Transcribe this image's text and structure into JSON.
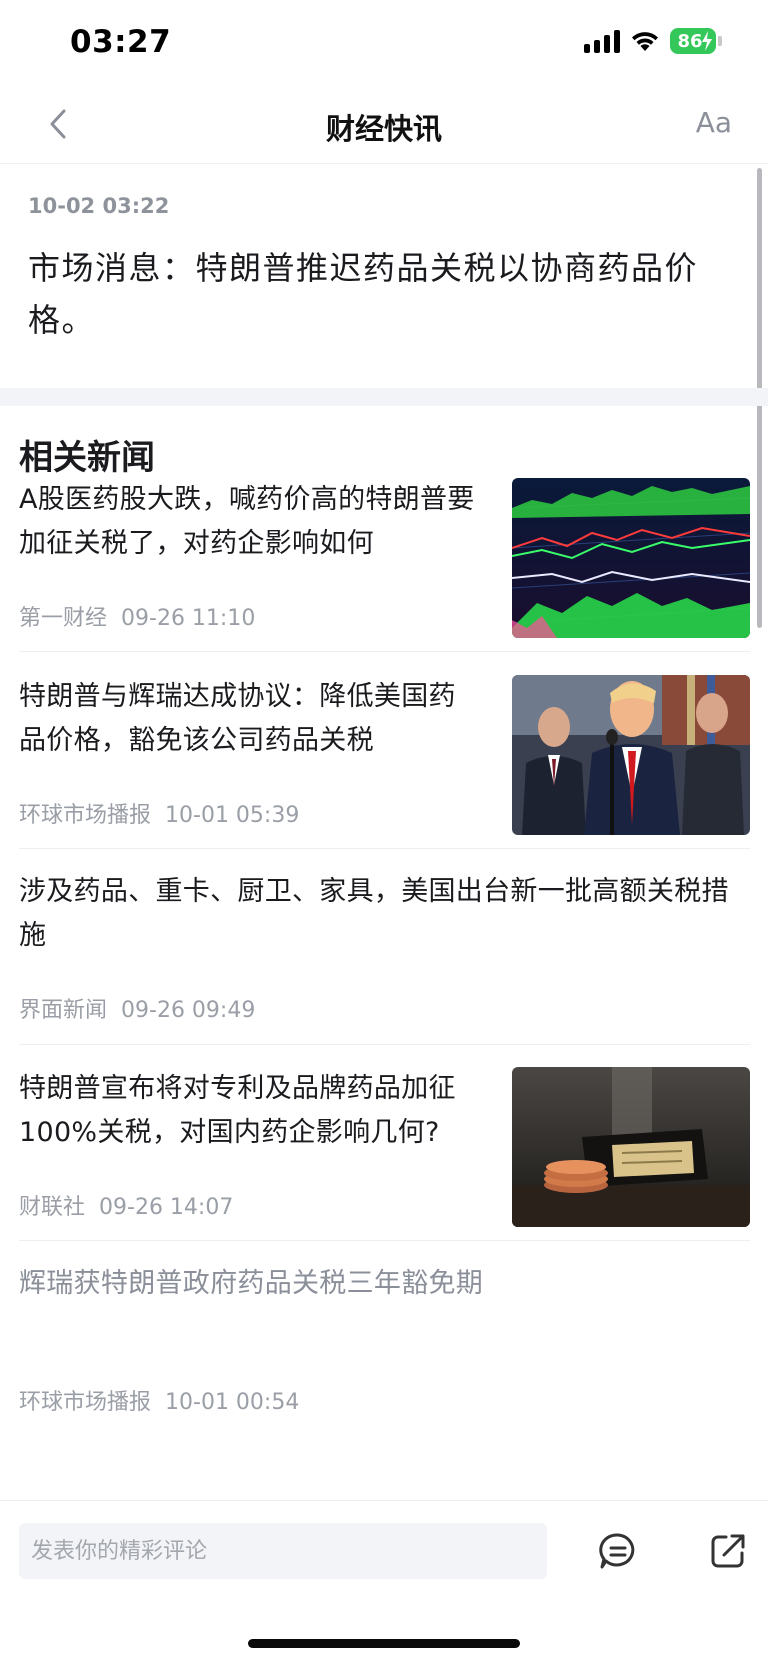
{
  "status_bar": {
    "time": "03:27",
    "battery": "86"
  },
  "nav": {
    "title": "财经快讯",
    "font_button": "Aa"
  },
  "article": {
    "timestamp": "10-02 03:22",
    "text": "市场消息：特朗普推迟药品关税以协商药品价格。"
  },
  "related": {
    "heading": "相关新闻",
    "items": [
      {
        "title": "A股医药股大跌，喊药价高的特朗普要加征关税了，对药企影响如何",
        "source": "第一财经",
        "time": "09-26 11:10",
        "image": "stock-chart-photo"
      },
      {
        "title": "特朗普与辉瑞达成协议：降低美国药品价格，豁免该公司药品关税",
        "source": "环球市场播报",
        "time": "10-01 05:39",
        "image": "press-conference-photo"
      },
      {
        "title": "涉及药品、重卡、厨卫、家具，美国出台新一批高额关税措施",
        "source": "界面新闻",
        "time": "09-26 09:49"
      },
      {
        "title": "特朗普宣布将对专利及品牌药品加征100%关税，对国内药企影响几何?",
        "source": "财联社",
        "time": "09-26 14:07",
        "image": "wallet-coins-photo"
      },
      {
        "title": "辉瑞获特朗普政府药品关税三年豁免期",
        "source": "环球市场播报",
        "time": "10-01 00:54"
      }
    ]
  },
  "comment_bar": {
    "placeholder": "发表你的精彩评论"
  },
  "colors": {
    "battery": "#34c759",
    "text": "#1b1b1f",
    "meta": "#9a9ea6",
    "divider": "#eceef1"
  }
}
